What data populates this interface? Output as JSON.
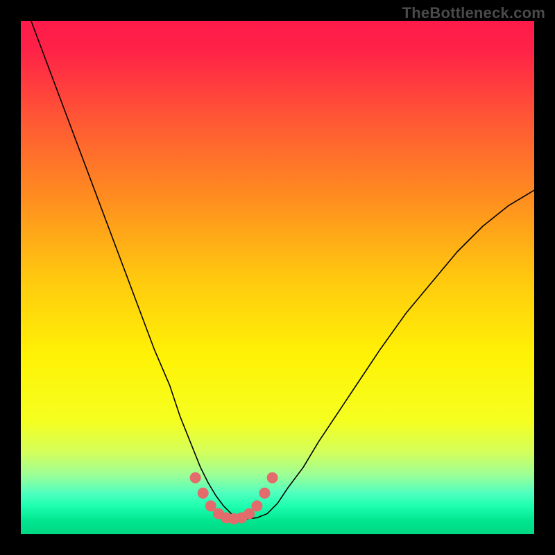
{
  "watermark": "TheBottleneck.com",
  "chart_data": {
    "type": "line",
    "title": "",
    "xlabel": "",
    "ylabel": "",
    "xlim": [
      0,
      100
    ],
    "ylim": [
      0,
      100
    ],
    "grid": false,
    "background_gradient": {
      "stops": [
        {
          "offset": 0.0,
          "color": "#ff1a4b"
        },
        {
          "offset": 0.06,
          "color": "#ff2347"
        },
        {
          "offset": 0.2,
          "color": "#ff5a33"
        },
        {
          "offset": 0.35,
          "color": "#ff8f1f"
        },
        {
          "offset": 0.5,
          "color": "#ffc80f"
        },
        {
          "offset": 0.65,
          "color": "#fff205"
        },
        {
          "offset": 0.78,
          "color": "#f5ff20"
        },
        {
          "offset": 0.84,
          "color": "#d4ff5a"
        },
        {
          "offset": 0.885,
          "color": "#9cff97"
        },
        {
          "offset": 0.92,
          "color": "#4fffc0"
        },
        {
          "offset": 0.945,
          "color": "#1effb0"
        },
        {
          "offset": 0.975,
          "color": "#00e58e"
        },
        {
          "offset": 1.0,
          "color": "#00d884"
        }
      ]
    },
    "series": [
      {
        "name": "bottleneck-curve",
        "color": "#000000",
        "width": 1.6,
        "x": [
          2,
          5,
          8,
          11,
          14,
          17,
          20,
          23,
          26,
          29,
          31,
          33,
          35,
          36.5,
          38,
          39.5,
          41,
          42.5,
          44,
          46,
          48,
          50,
          52,
          55,
          58,
          62,
          66,
          70,
          75,
          80,
          85,
          90,
          95,
          100
        ],
        "y": [
          100,
          92,
          84,
          76,
          68,
          60,
          52,
          44,
          36,
          29,
          23,
          18,
          13,
          10,
          7.5,
          5.5,
          4,
          3.2,
          3,
          3.2,
          4,
          6,
          9,
          13,
          18,
          24,
          30,
          36,
          43,
          49,
          55,
          60,
          64,
          67
        ]
      }
    ],
    "marker_run": {
      "name": "highlight-band",
      "color": "#e36b6b",
      "radius": 8,
      "x": [
        34,
        35.5,
        37,
        38.5,
        40,
        41.5,
        43,
        44.5,
        46,
        47.5,
        49
      ],
      "y": [
        11,
        8,
        5.5,
        4,
        3.2,
        3,
        3.2,
        4,
        5.5,
        8,
        11
      ]
    }
  }
}
